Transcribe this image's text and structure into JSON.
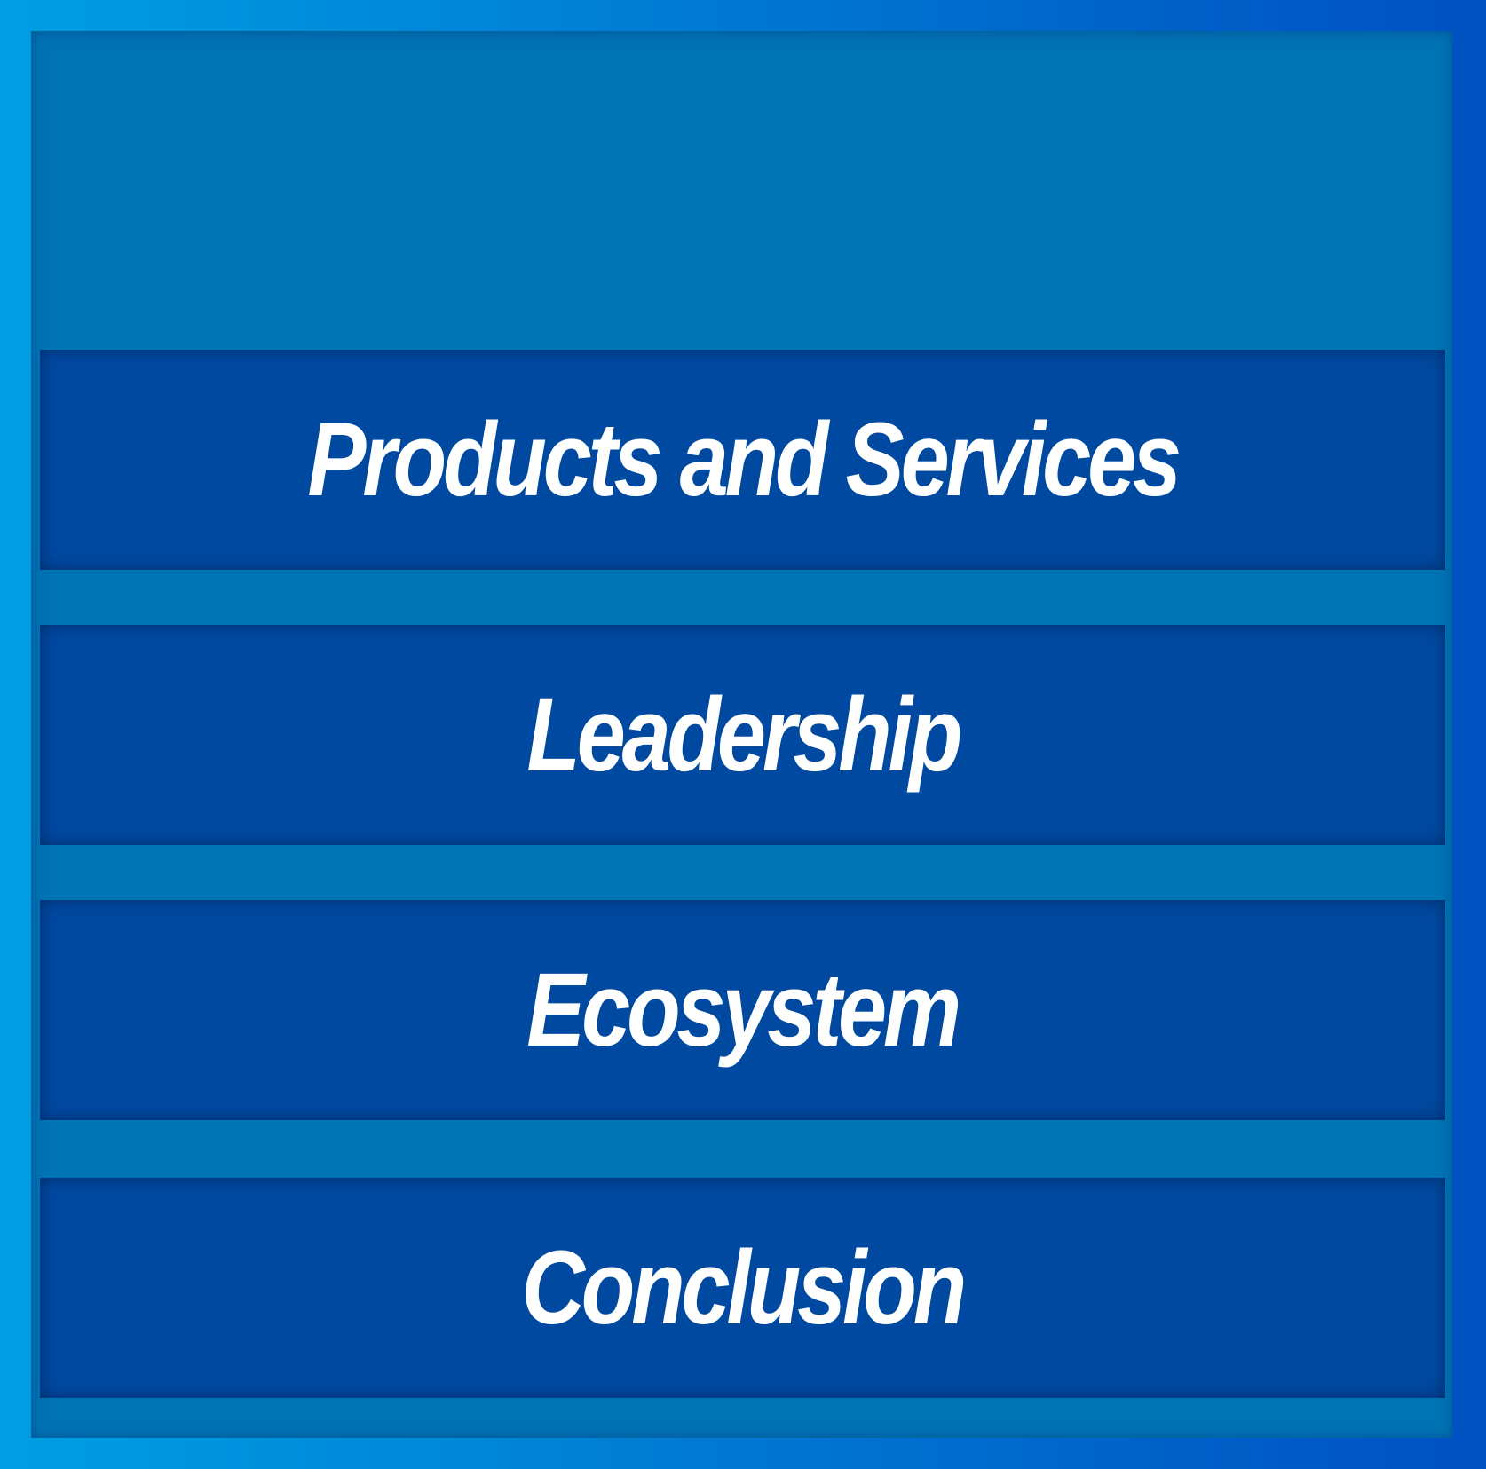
{
  "menu": {
    "items": [
      {
        "label": "Products and Services"
      },
      {
        "label": "Leadership"
      },
      {
        "label": "Ecosystem"
      },
      {
        "label": "Conclusion"
      }
    ]
  },
  "colors": {
    "frame_gradient_start": "#009ee3",
    "frame_gradient_end": "#0050c2",
    "panel": "#0073b5",
    "item_background": "#0049a0",
    "text": "#ffffff"
  }
}
